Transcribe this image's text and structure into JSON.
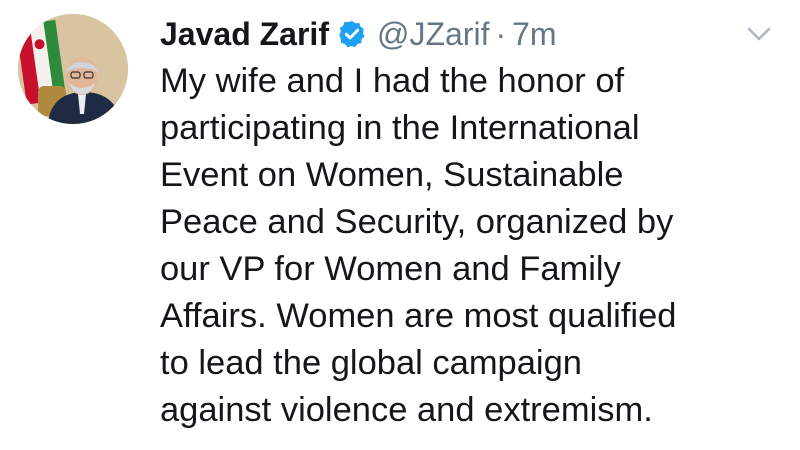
{
  "tweet": {
    "author": {
      "display_name": "Javad Zarif",
      "handle": "@JZarif",
      "verified": true
    },
    "separator": "·",
    "timestamp": "7m",
    "text_lines": [
      "My wife and I had the honor of",
      "participating in the International",
      "Event on Women, Sustainable",
      "Peace and Security, organized by",
      "our VP for Women and Family",
      "Affairs. Women are most qualified",
      "to lead the global campaign",
      "against violence and extremism."
    ]
  },
  "icons": {
    "verified": "verified-badge-icon",
    "more": "chevron-down-icon"
  },
  "colors": {
    "text": "#14171a",
    "secondary_text": "#657786",
    "verified_blue": "#1da1f2",
    "caret_gray": "#aab8c2",
    "background": "#ffffff"
  }
}
